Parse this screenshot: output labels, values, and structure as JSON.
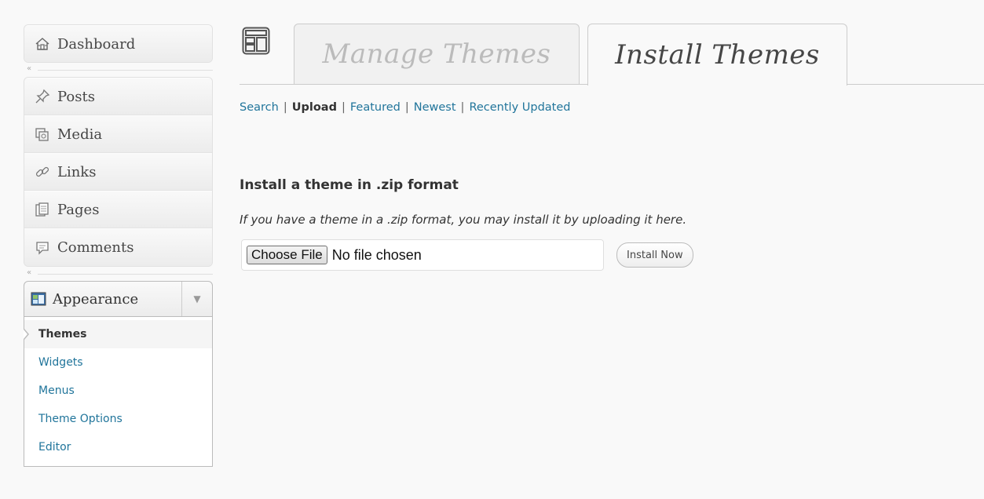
{
  "sidebar": {
    "dashboard": {
      "label": "Dashboard",
      "icon": "home-icon"
    },
    "collapse_glyph": "«",
    "items": [
      {
        "label": "Posts",
        "icon": "pushpin-icon"
      },
      {
        "label": "Media",
        "icon": "media-icon"
      },
      {
        "label": "Links",
        "icon": "link-icon"
      },
      {
        "label": "Pages",
        "icon": "pages-icon"
      },
      {
        "label": "Comments",
        "icon": "comment-icon"
      }
    ],
    "appearance": {
      "label": "Appearance",
      "icon": "appearance-icon",
      "toggle_glyph": "▼",
      "submenu": [
        {
          "label": "Themes",
          "current": true
        },
        {
          "label": "Widgets"
        },
        {
          "label": "Menus"
        },
        {
          "label": "Theme Options"
        },
        {
          "label": "Editor"
        }
      ]
    }
  },
  "tabs": {
    "manage": "Manage Themes",
    "install": "Install Themes",
    "active": "Install Themes"
  },
  "subnav": {
    "items": [
      "Search",
      "Upload",
      "Featured",
      "Newest",
      "Recently Updated"
    ],
    "current": "Upload",
    "separator": "|"
  },
  "upload": {
    "heading": "Install a theme in .zip format",
    "description": "If you have a theme in a .zip format, you may install it by uploading it here.",
    "choose_file_label": "Choose File",
    "file_status": "No file chosen",
    "install_button": "Install Now"
  },
  "colors": {
    "link": "#21759b",
    "background": "#f9f9f9",
    "menu_bg": "#f1f1f1"
  }
}
